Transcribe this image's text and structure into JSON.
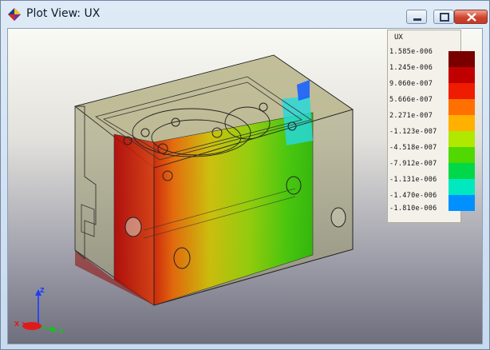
{
  "window": {
    "title": "Plot View: UX",
    "controls": [
      "minimize-icon",
      "restore-icon",
      "close-icon"
    ]
  },
  "legend": {
    "title": "UX",
    "values": [
      "1.585e-006",
      "1.245e-006",
      "9.060e-007",
      "5.666e-007",
      "2.271e-007",
      "-1.123e-007",
      "-4.518e-007",
      "-7.912e-007",
      "-1.131e-006",
      "-1.470e-006",
      "-1.810e-006"
    ],
    "colors": [
      "#7a0000",
      "#c00000",
      "#ee1c00",
      "#ff7000",
      "#ffb000",
      "#b0e800",
      "#50d800",
      "#00d84a",
      "#00e8c0",
      "#0090ff",
      "#0000e0"
    ]
  },
  "axis_triad": {
    "x_label": "X",
    "y_label": "Y",
    "z_label": "Z"
  },
  "colors": {
    "title_bar": "#c8daee",
    "close_button": "#d0442f"
  }
}
